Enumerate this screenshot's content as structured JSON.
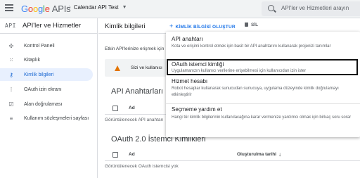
{
  "topbar": {
    "logo_parts": [
      "G",
      "o",
      "o",
      "g",
      "l",
      "e"
    ],
    "logo_suffix": "APIs",
    "project_name": "Calendar API Test",
    "search_placeholder": "API'ler ve Hizmetleri arayın"
  },
  "sidebar": {
    "badge": "API",
    "title": "API'ler ve Hizmetler",
    "items": [
      {
        "label": "Kontrol Paneli",
        "icon": "dashboard-icon"
      },
      {
        "label": "Kitaplık",
        "icon": "library-icon"
      },
      {
        "label": "Kimlik bilgileri",
        "icon": "key-icon",
        "active": true
      },
      {
        "label": "OAuth izin ekranı",
        "icon": "consent-icon"
      },
      {
        "label": "Alan doğrulaması",
        "icon": "checkbox-icon"
      },
      {
        "label": "Kullanım sözleşmeleri sayfası",
        "icon": "settings-list-icon"
      }
    ]
  },
  "main": {
    "title": "Kimlik bilgileri",
    "create_label": "KİMLİK BİLGİSİ OLUŞTUR",
    "delete_label": "SİL",
    "info_text": "Etkin API'lerinize erişmek için",
    "warning_text": "Sizi ve kullanıcı",
    "api_keys": {
      "title": "API Anahtarları",
      "col_name": "Ad",
      "empty": "Görüntülenecek API anahtarı"
    },
    "oauth": {
      "title": "OAuth 2.0 İstemci Kimlikleri",
      "col_name": "Ad",
      "col_created": "Oluşturulma tarihi",
      "empty": "Görüntülenecek OAuth istemcisi yok"
    }
  },
  "dropdown": {
    "items": [
      {
        "title": "API anahtarı",
        "desc": "Kota ve erişimi kontrol etmek için basit bir API anahtarını kullanarak projenizi tanımlar"
      },
      {
        "title": "OAuth istemci kimliği",
        "desc": "Uygulamanızın kullanıcı verilerine erişebilmesi için kullanıcıdan izin ister",
        "highlighted": true
      },
      {
        "title": "Hizmet hesabı",
        "desc": "Robot hesaplar kullanarak sunucudan sunucuya, uygulama düzeyinde kimlik doğrulamayı etkinleştirir"
      },
      {
        "title": "Seçmeme yardım et",
        "desc": "Hangi tür kimlik bilgilerinin kullanılacağına karar vermenize yardımcı olmak için birkaç soru sorar"
      }
    ]
  },
  "colors": {
    "accent": "#1a73e8",
    "active_bg": "#e8f0fe",
    "warning": "#e37400"
  }
}
